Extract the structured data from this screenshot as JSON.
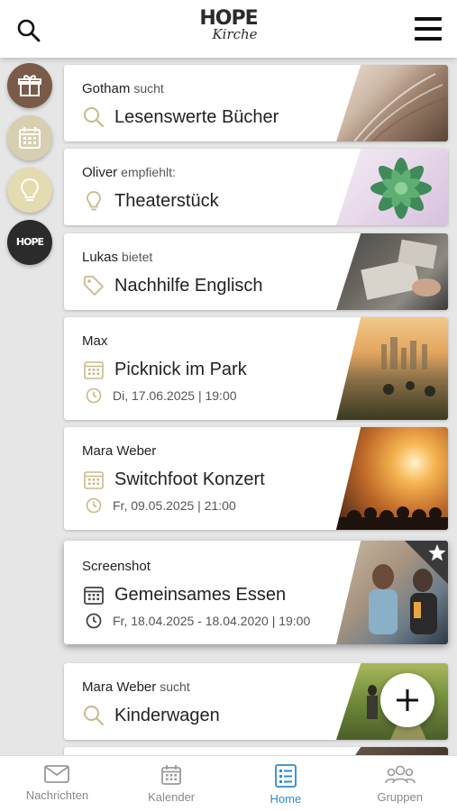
{
  "header": {
    "logo_line1": "HOPE",
    "logo_line2": "Kirche"
  },
  "sidebar": {
    "items": [
      {
        "name": "gift",
        "icon": "gift-icon",
        "color": "#7a5a48"
      },
      {
        "name": "calendar",
        "icon": "calendar-icon",
        "color": "#d8cfb2"
      },
      {
        "name": "idea",
        "icon": "lightbulb-icon",
        "color": "#e4dbb0"
      },
      {
        "name": "hope",
        "icon": "hope-logo",
        "color": "#2b2b2b",
        "text": "HOPE"
      }
    ]
  },
  "cards": [
    {
      "who": "Gotham",
      "verb": "sucht",
      "title": "Lesenswerte Bücher",
      "icon": "search-icon"
    },
    {
      "who": "Oliver",
      "verb": "empfiehlt:",
      "title": "Theaterstück",
      "icon": "lightbulb-icon"
    },
    {
      "who": "Lukas",
      "verb": "bietet",
      "title": "Nachhilfe Englisch",
      "icon": "tag-icon"
    },
    {
      "who": "Max",
      "verb": "",
      "title": "Picknick im Park",
      "date": "Di, 17.06.2025 | 19:00",
      "icon": "calendar-icon"
    },
    {
      "who": "Mara Weber",
      "verb": "",
      "title": "Switchfoot Konzert",
      "date": "Fr, 09.05.2025 | 21:00",
      "icon": "calendar-icon"
    },
    {
      "who": "Screenshot",
      "verb": "",
      "title": "Gemeinsames Essen",
      "date": "Fr, 18.04.2025 - 18.04.2020 | 19:00",
      "icon": "calendar-icon",
      "starred": true
    },
    {
      "who": "Mara Weber",
      "verb": "sucht",
      "title": "Kinderwagen",
      "icon": "search-icon"
    }
  ],
  "tabs": [
    {
      "label": "Nachrichten",
      "icon": "mail-icon",
      "active": false
    },
    {
      "label": "Kalender",
      "icon": "calendar-icon",
      "active": false
    },
    {
      "label": "Home",
      "icon": "list-icon",
      "active": true
    },
    {
      "label": "Gruppen",
      "icon": "group-icon",
      "active": false
    }
  ],
  "colors": {
    "accent": "#2a8ad4",
    "muted_icon": "#cfc29a",
    "dark_icon": "#444444"
  }
}
